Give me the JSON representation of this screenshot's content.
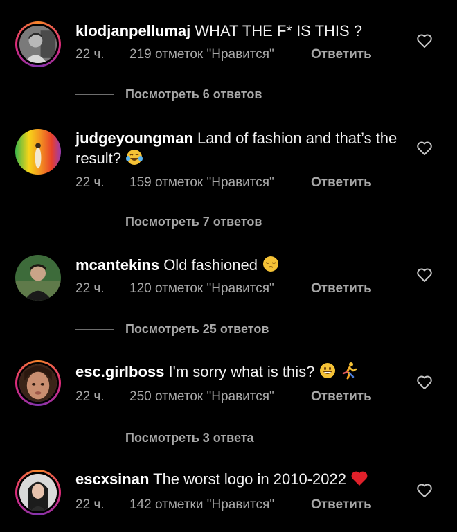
{
  "comments": [
    {
      "username": "klodjanpellumaj",
      "text": "WHAT THE F* IS THIS ?",
      "time": "22 ч.",
      "likes": "219 отметок \"Нравится\"",
      "reply": "Ответить",
      "view_replies": "Посмотреть 6 ответов",
      "avatar": "person-photo-gray",
      "story_ring": true
    },
    {
      "username": "judgeyoungman",
      "text": "Land of fashion and that’s the result?",
      "emoji": "face-with-tears-of-joy",
      "time": "22 ч.",
      "likes": "159 отметок \"Нравится\"",
      "reply": "Ответить",
      "view_replies": "Посмотреть 7 ответов",
      "avatar": "rainbow-background-figure",
      "story_ring": false
    },
    {
      "username": "mcantekins",
      "text": "Old fashioned",
      "emoji": "pensive-face",
      "time": "22 ч.",
      "likes": "120 отметок \"Нравится\"",
      "reply": "Ответить",
      "view_replies": "Посмотреть 25 ответов",
      "avatar": "person-photo-green",
      "story_ring": false
    },
    {
      "username": "esc.girlboss",
      "text": "I'm sorry what is this?",
      "emoji": "grinning-face running-person",
      "time": "22 ч.",
      "likes": "250 отметок \"Нравится\"",
      "reply": "Ответить",
      "view_replies": "Посмотреть 3 ответа",
      "avatar": "face-closeup",
      "story_ring": true
    },
    {
      "username": "escxsinan",
      "text": "The worst logo in 2010-2022",
      "emoji": "red-heart",
      "time": "22 ч.",
      "likes": "142 отметки \"Нравится\"",
      "reply": "Ответить",
      "avatar": "person-photo-dark-hair",
      "story_ring": true
    }
  ],
  "colors": {
    "background": "#000000",
    "secondary_text": "#a8a8a8",
    "primary_text": "#f5f5f5"
  }
}
